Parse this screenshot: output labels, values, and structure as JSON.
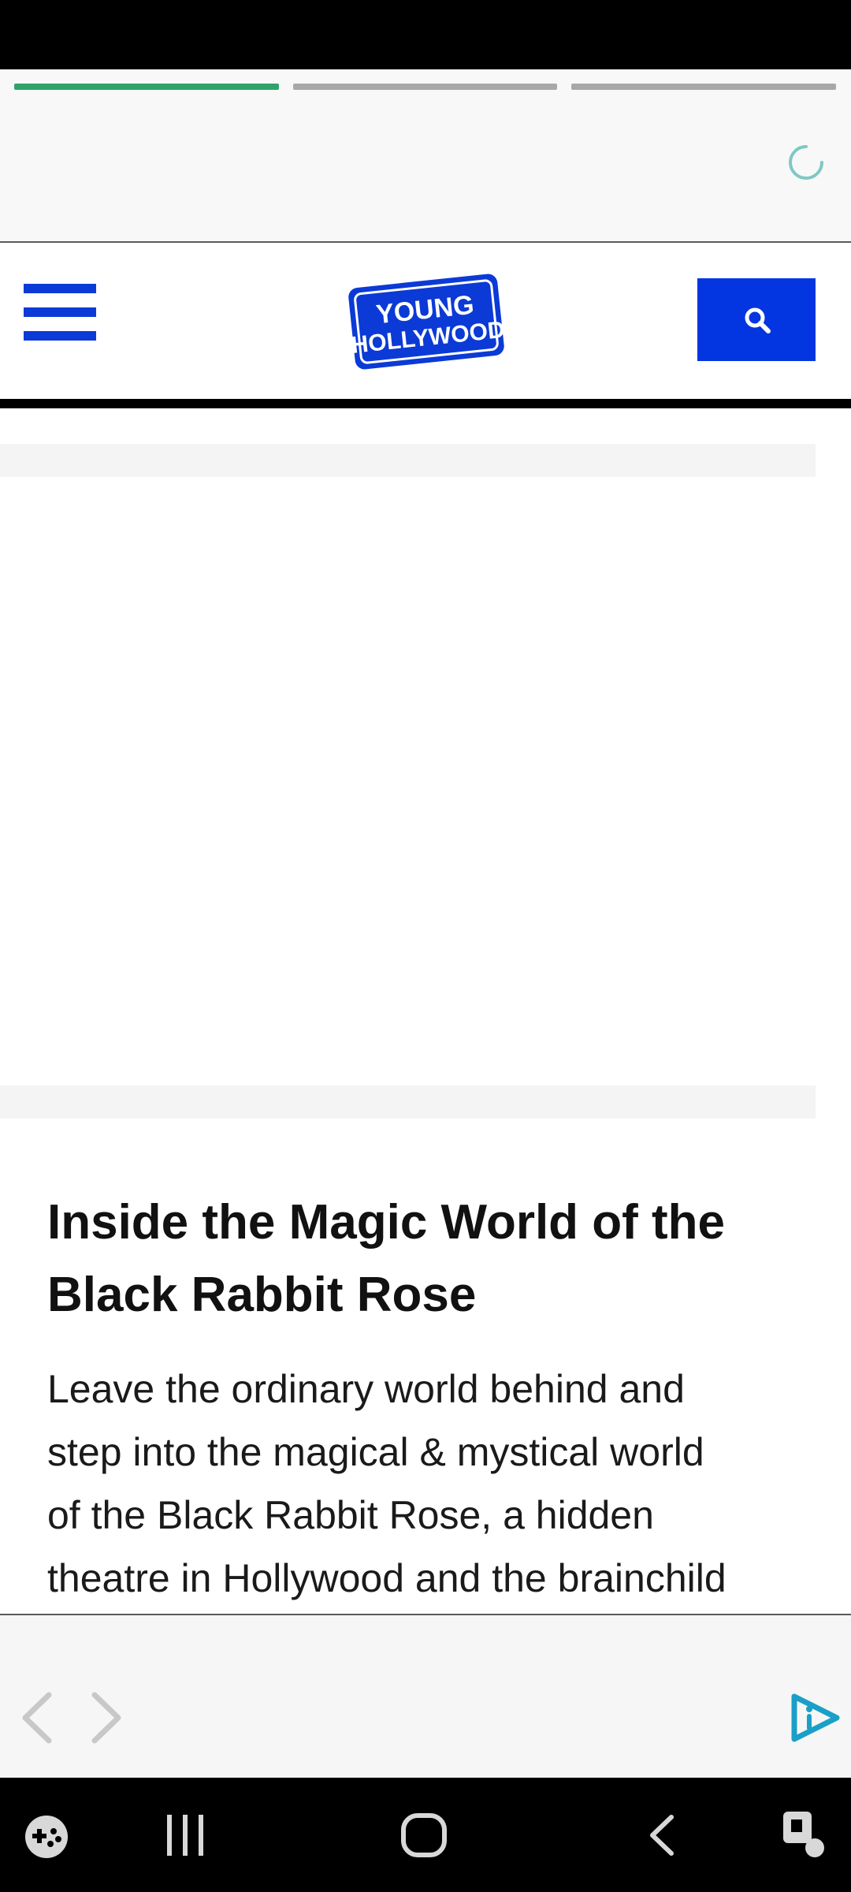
{
  "header": {
    "logo_text_line1": "YOUNG",
    "logo_text_line2": "HOLLYWOOD"
  },
  "stories": {
    "segments": [
      {
        "state": "active",
        "color": "#2fa36b"
      },
      {
        "state": "pending",
        "color": "#a8a8a8"
      },
      {
        "state": "pending",
        "color": "#a8a8a8"
      }
    ],
    "loading_icon": "spinner-icon"
  },
  "article": {
    "title": "Inside the Magic World of the Black Rabbit Rose",
    "body_lines": [
      "Leave the ordinary world behind and",
      "step into the magical & mystical world",
      "of the Black Rabbit Rose, a hidden",
      "theatre in Hollywood and the brainchild"
    ]
  },
  "toolbar": {
    "back_icon": "chevron-left-icon",
    "forward_icon": "chevron-right-icon",
    "brand_icon": "play-info-icon"
  },
  "nav": {
    "icons": [
      "game-launcher-icon",
      "recent-apps-icon",
      "home-icon",
      "back-icon",
      "accessibility-icon"
    ]
  },
  "colors": {
    "brand_blue": "#0336e0",
    "progress_active": "#2fa36b",
    "accent_teal": "#1aa0c8"
  }
}
